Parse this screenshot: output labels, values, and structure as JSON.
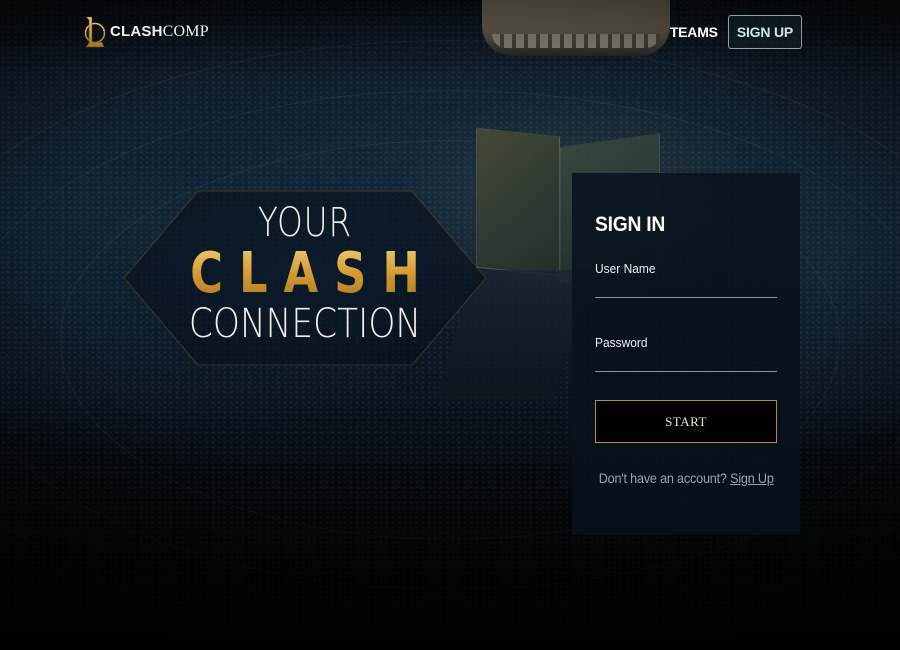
{
  "nav": {
    "brand_text_bold": "CLASH",
    "brand_text": "COMP",
    "brand_logo_icon": "league-l-logo-icon",
    "teams_label": "TEAMS",
    "signup_label": "SIGN UP"
  },
  "hero": {
    "line1": "YOUR",
    "line2": "CLASH",
    "line3": "CONNECTION"
  },
  "signin": {
    "title": "SIGN IN",
    "username_label": "User Name",
    "username_value": "",
    "password_label": "Password",
    "password_value": "",
    "start_label": "START",
    "no_account_text": "Don't have an account?",
    "signup_link_label": "Sign Up"
  },
  "colors": {
    "accent_gold": "#b58f3c",
    "card_bg": "#08121c",
    "nav_signup_border": "#8fa3a4"
  }
}
